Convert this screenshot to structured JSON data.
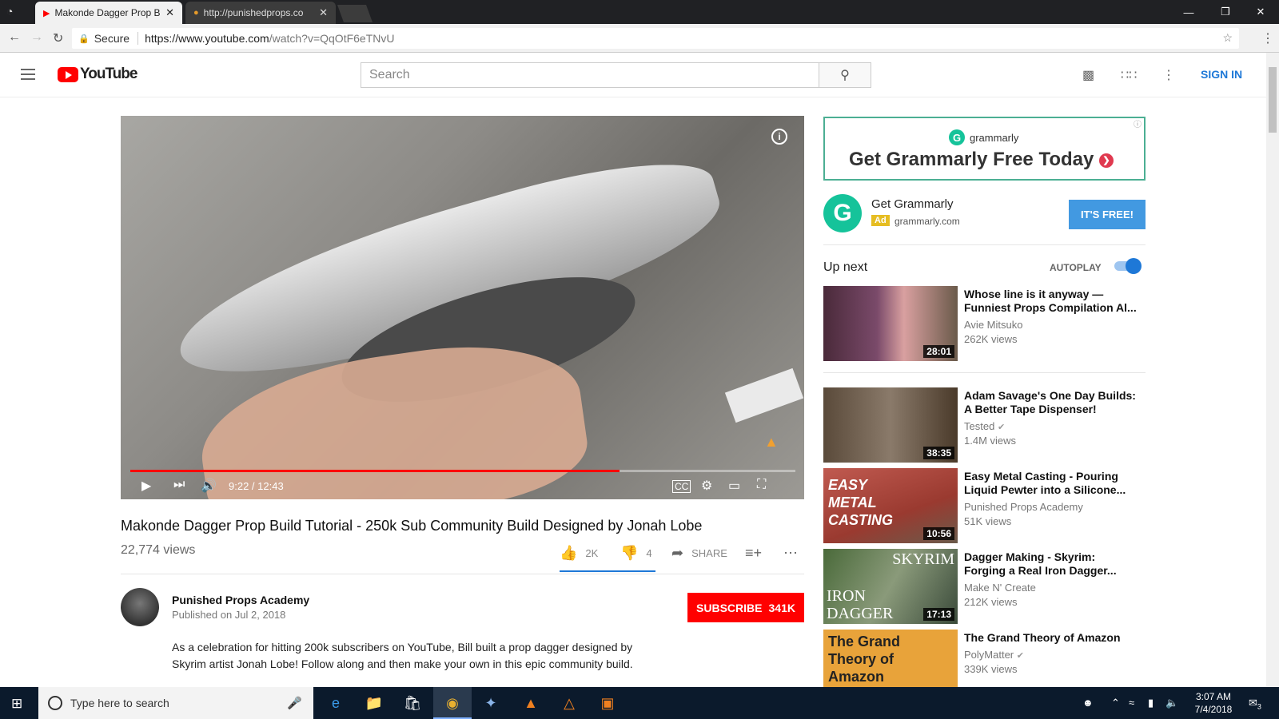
{
  "browser": {
    "tabs": [
      {
        "title": "Makonde Dagger Prop B",
        "active": true
      },
      {
        "title": "http://punishedprops.co",
        "active": false
      }
    ],
    "secure_label": "Secure",
    "url_host": "https://www.youtube.com",
    "url_path": "/watch?v=QqOtF6eTNvU"
  },
  "youtube": {
    "logo_text": "YouTube",
    "search_placeholder": "Search",
    "sign_in": "SIGN IN"
  },
  "player": {
    "time": "9:22 / 12:43",
    "progress_fraction": 0.736
  },
  "video": {
    "title": "Makonde Dagger Prop Build Tutorial - 250k Sub Community Build Designed by Jonah Lobe",
    "views": "22,774 views",
    "likes": "2K",
    "dislikes": "4",
    "share_label": "SHARE",
    "channel": "Punished Props Academy",
    "published": "Published on Jul 2, 2018",
    "subscribe_label": "SUBSCRIBE",
    "subscriber_count": "341K",
    "description": "As a celebration for hitting 200k subscribers on YouTube, Bill built a prop dagger designed by Skyrim artist Jonah Lobe! Follow along and then make your own in this epic community build."
  },
  "ad": {
    "brand": "grammarly",
    "headline": "Get Grammarly Free Today",
    "name": "Get Grammarly",
    "badge": "Ad",
    "domain": "grammarly.com",
    "cta": "IT'S FREE!"
  },
  "sidebar": {
    "up_next": "Up next",
    "autoplay_label": "AUTOPLAY",
    "autoplay_on": true,
    "items": [
      {
        "title": "Whose line is it anyway — Funniest Props Compilation Al...",
        "channel": "Avie Mitsuko",
        "views": "262K views",
        "duration": "28:01",
        "verified": false
      },
      {
        "title": "Adam Savage's One Day Builds: A Better Tape Dispenser!",
        "channel": "Tested",
        "views": "1.4M views",
        "duration": "38:35",
        "verified": true
      },
      {
        "title": "Easy Metal Casting - Pouring Liquid Pewter into a Silicone...",
        "channel": "Punished Props Academy",
        "views": "51K views",
        "duration": "10:56",
        "verified": false,
        "thumb_text": "EASY METAL CASTING"
      },
      {
        "title": "Dagger Making - Skyrim: Forging a Real Iron Dagger...",
        "channel": "Make N' Create",
        "views": "212K views",
        "duration": "17:13",
        "verified": false,
        "thumb_text_top": "SKYRIM",
        "thumb_text_bottom": "IRON DAGGER"
      },
      {
        "title": "The Grand Theory of Amazon",
        "channel": "PolyMatter",
        "views": "339K views",
        "duration": "",
        "verified": true,
        "thumb_text": "The Grand Theory of Amazon"
      }
    ]
  },
  "taskbar": {
    "search_placeholder": "Type here to search",
    "time": "3:07 AM",
    "date": "7/4/2018",
    "notifications": "3"
  }
}
